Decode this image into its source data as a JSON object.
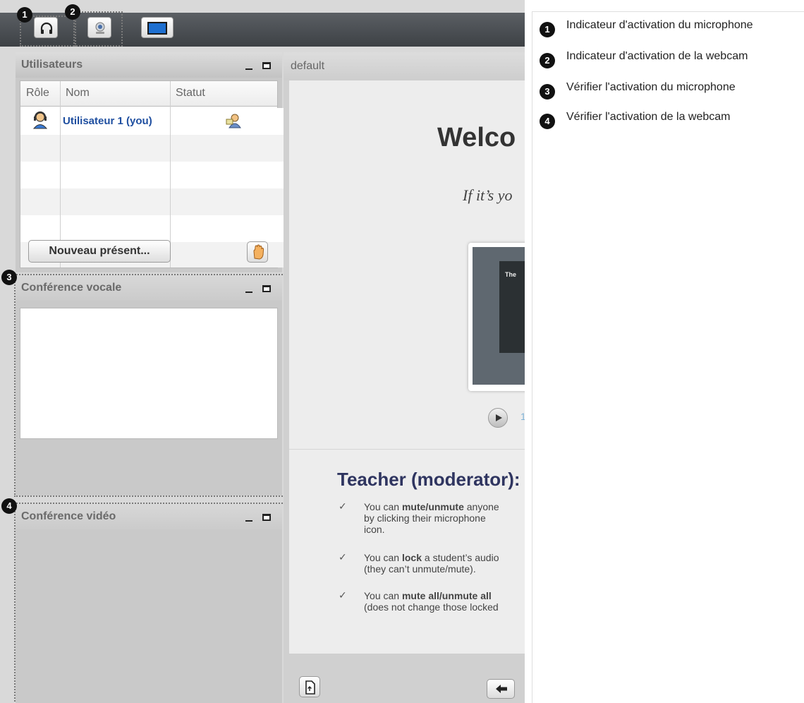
{
  "badges": [
    "1",
    "2",
    "3",
    "4"
  ],
  "users_panel": {
    "title": "Utilisateurs",
    "columns": [
      "Rôle",
      "Nom",
      "Statut"
    ],
    "rows": [
      {
        "name": "Utilisateur 1 (you)",
        "role_icon": "moderator-icon",
        "status_icon": "presenter-icon"
      }
    ],
    "new_presenter_button": "Nouveau présent...",
    "raise_hand_icon": "raise-hand-icon"
  },
  "voice_panel": {
    "title": "Conférence vocale"
  },
  "video_panel": {
    "title": "Conférence vidéo"
  },
  "presentation": {
    "title": "default",
    "slide": {
      "heading": "Welco",
      "subheading": "If it’s yo",
      "thumb_text": "The",
      "play_label": "1",
      "teacher_heading": "Teacher (moderator):",
      "bullets": [
        {
          "lines": [
            "You can <b>mute/unmute</b> anyone",
            "by clicking their microphone",
            "icon."
          ]
        },
        {
          "lines": [
            "You can <b>lock</b> a student’s audio",
            "(they can’t unmute/mute)."
          ]
        },
        {
          "lines": [
            "You can <b>mute all/unmute all</b>",
            "(does not change those locked"
          ]
        }
      ]
    }
  },
  "toolbar": {
    "buttons": [
      "headset-icon",
      "webcam-icon",
      "desktop-share-icon"
    ]
  },
  "legend": [
    {
      "num": "1",
      "text": "Indicateur d'activation du microphone"
    },
    {
      "num": "2",
      "text": "Indicateur d'activation de la webcam"
    },
    {
      "num": "3",
      "text": "Vérifier l'activation du microphone"
    },
    {
      "num": "4",
      "text": "Vérifier l'activation de la webcam"
    }
  ],
  "colors": {
    "topbar": "#4a4e52",
    "link_blue": "#1f4fa0",
    "teacher_blue": "#2f3560"
  }
}
